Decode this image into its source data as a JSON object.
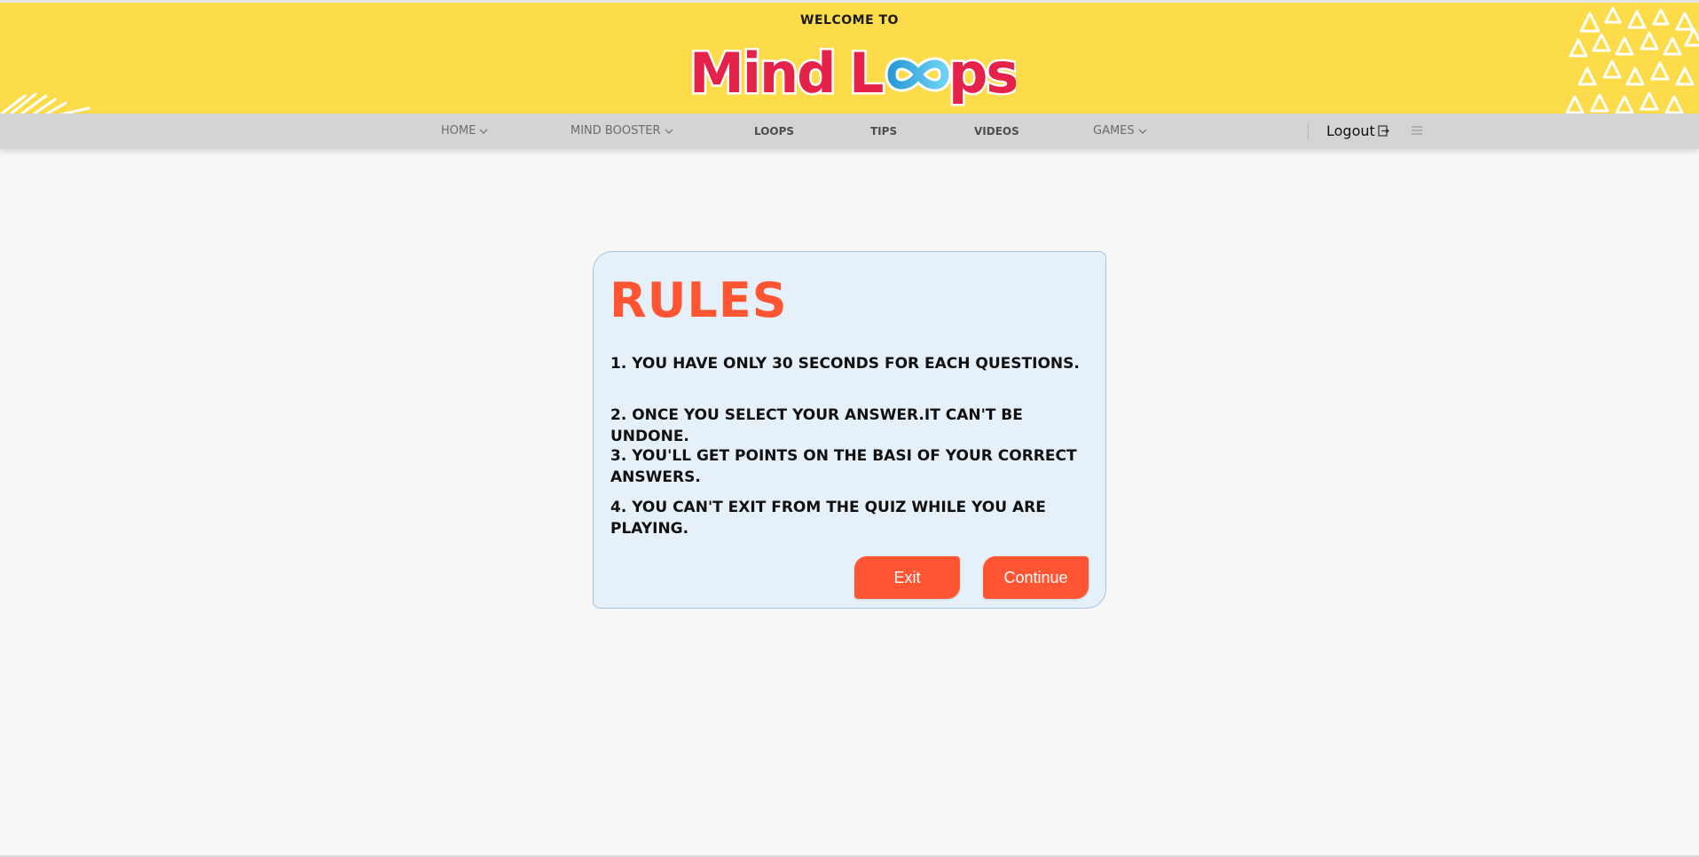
{
  "header": {
    "welcome": "WELCOME TO",
    "logo_text": "MindLoops"
  },
  "nav": {
    "items": [
      {
        "label": "HOME",
        "has_dropdown": true
      },
      {
        "label": "MIND BOOSTER",
        "has_dropdown": true
      },
      {
        "label": "LOOPS",
        "has_dropdown": false
      },
      {
        "label": "TIPS",
        "has_dropdown": false
      },
      {
        "label": "VIDEOS",
        "has_dropdown": false
      },
      {
        "label": "GAMES",
        "has_dropdown": true
      }
    ],
    "logout": "Logout",
    "icons": {
      "logout": "logout-icon",
      "menu": "hamburger-menu-icon",
      "dropdown": "chevron-down-icon"
    }
  },
  "rules": {
    "title": "RULES",
    "items": [
      "1. YOU HAVE ONLY 30 SECONDS FOR EACH QUESTIONS.",
      "2. ONCE YOU SELECT YOUR ANSWER.IT CAN'T BE UNDONE.",
      "3. YOU'LL GET POINTS ON THE BASI OF YOUR CORRECT ANSWERS.",
      "4. YOU CAN'T EXIT FROM THE QUIZ WHILE YOU ARE PLAYING."
    ],
    "exit_label": "Exit",
    "continue_label": "Continue"
  },
  "colors": {
    "header_bg": "#fcdc4a",
    "nav_bg": "#d4d4d4",
    "accent": "#ff5533",
    "card_bg": "#e6f0f8",
    "logo_pink": "#e5224a",
    "logo_blue": "#3cb7e8"
  }
}
